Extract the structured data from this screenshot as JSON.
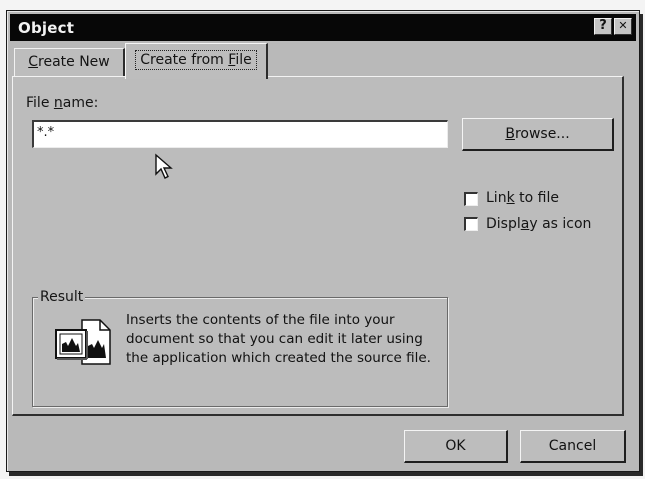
{
  "window": {
    "title": "Object",
    "help_glyph": "?",
    "close_glyph": "✕"
  },
  "tabs": [
    {
      "label_pre": "",
      "label_key": "C",
      "label_post": "reate New",
      "selected": false
    },
    {
      "label_pre": "Create from ",
      "label_key": "F",
      "label_post": "ile",
      "selected": true
    }
  ],
  "file_name": {
    "label_pre": "File ",
    "label_key": "n",
    "label_post": "ame:",
    "value": "*.*"
  },
  "browse": {
    "label_key": "B",
    "label_post": "rowse..."
  },
  "options": {
    "link_pre": "Lin",
    "link_key": "k",
    "link_post": " to file",
    "link_checked": false,
    "icon_pre": "Displ",
    "icon_key": "a",
    "icon_post": "y as icon",
    "icon_checked": false
  },
  "result": {
    "title": "Result",
    "text": "Inserts the contents of the file into your document so that you can edit it later using the application which created the source file."
  },
  "footer": {
    "ok_label": "OK",
    "cancel_label": "Cancel"
  },
  "icons": {
    "help": "help-icon",
    "close": "close-icon",
    "cursor": "mouse-pointer-icon",
    "result": "embedded-file-icon"
  }
}
